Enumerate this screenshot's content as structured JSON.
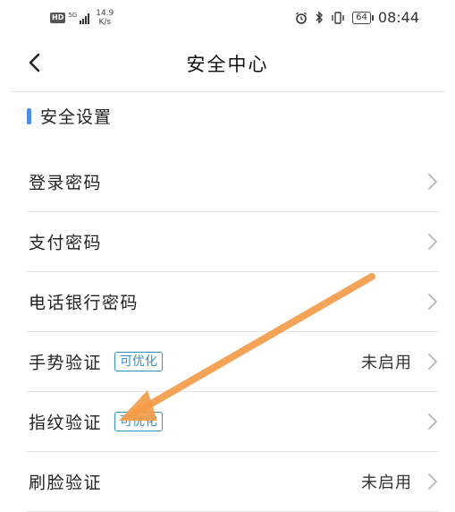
{
  "status_bar": {
    "hd": "HD",
    "network": "5G",
    "speed_value": "14.9",
    "speed_unit": "K/s",
    "battery": "64",
    "time": "08:44"
  },
  "nav": {
    "title": "安全中心"
  },
  "section": {
    "title": "安全设置"
  },
  "items": [
    {
      "label": "登录密码",
      "badge": "",
      "value": ""
    },
    {
      "label": "支付密码",
      "badge": "",
      "value": ""
    },
    {
      "label": "电话银行密码",
      "badge": "",
      "value": ""
    },
    {
      "label": "手势验证",
      "badge": "可优化",
      "value": "未启用"
    },
    {
      "label": "指纹验证",
      "badge": "可优化",
      "value": ""
    },
    {
      "label": "刷脸验证",
      "badge": "",
      "value": "未启用"
    }
  ],
  "colors": {
    "accent": "#4a90e2",
    "badge": "#3a8fb8",
    "annotation_arrow": "#f39a45"
  },
  "icons": [
    "back-arrow-icon",
    "chevron-right-icon",
    "alarm-icon",
    "bluetooth-icon",
    "vibrate-icon",
    "battery-icon",
    "signal-icon"
  ]
}
